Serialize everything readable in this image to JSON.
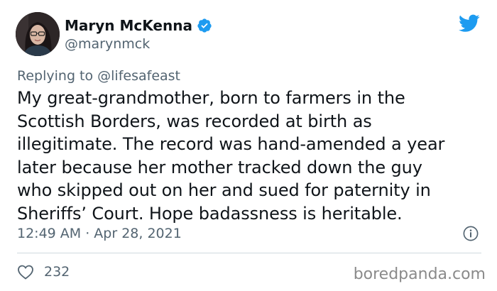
{
  "author": {
    "display_name": "Maryn McKenna",
    "handle": "@marynmck",
    "verified": true
  },
  "reply_context": "Replying to @lifesafeast",
  "tweet": {
    "text": "My great-grandmother, born to farmers in the\nScottish Borders, was recorded at birth as\nillegitimate. The record was hand-amended a year\nlater because her mother tracked down the guy\nwho skipped out on her and sued for paternity in\nSheriffs’ Court. Hope badassness is heritable.",
    "timestamp": "12:49 AM · Apr 28, 2021",
    "like_count": "232"
  },
  "watermark": "boredpanda.com",
  "colors": {
    "text": "#0f1419",
    "secondary_text": "#536471",
    "twitter_blue": "#1d9bf0",
    "divider": "#cfd9de",
    "watermark": "#8a8a8a"
  },
  "icons": {
    "verified": "verified-badge-icon",
    "brand": "twitter-bird-icon",
    "info": "info-icon",
    "like": "heart-icon"
  }
}
